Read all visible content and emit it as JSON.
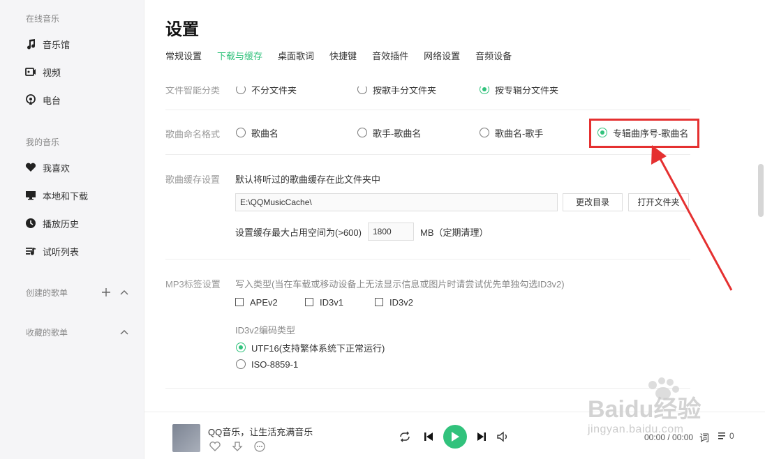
{
  "sidebar": {
    "online_title": "在线音乐",
    "online_items": [
      {
        "label": "音乐馆",
        "icon": "music-note-icon"
      },
      {
        "label": "视频",
        "icon": "video-icon"
      },
      {
        "label": "电台",
        "icon": "radio-icon"
      }
    ],
    "my_title": "我的音乐",
    "my_items": [
      {
        "label": "我喜欢",
        "icon": "heart-icon"
      },
      {
        "label": "本地和下载",
        "icon": "monitor-icon"
      },
      {
        "label": "播放历史",
        "icon": "clock-icon"
      },
      {
        "label": "试听列表",
        "icon": "playlist-icon"
      }
    ],
    "created_title": "创建的歌单",
    "collected_title": "收藏的歌单"
  },
  "header": {
    "title": "设置",
    "tabs": [
      {
        "label": "常规设置",
        "active": false
      },
      {
        "label": "下载与缓存",
        "active": true
      },
      {
        "label": "桌面歌词",
        "active": false
      },
      {
        "label": "快捷键",
        "active": false
      },
      {
        "label": "音效插件",
        "active": false
      },
      {
        "label": "网络设置",
        "active": false
      },
      {
        "label": "音频设备",
        "active": false
      }
    ]
  },
  "settings": {
    "smart_folder": {
      "label": "文件智能分类",
      "options": [
        "不分文件夹",
        "按歌手分文件夹",
        "按专辑分文件夹"
      ]
    },
    "naming": {
      "label": "歌曲命名格式",
      "options": [
        "歌曲名",
        "歌手-歌曲名",
        "歌曲名-歌手",
        "专辑曲序号-歌曲名"
      ],
      "selected": "专辑曲序号-歌曲名"
    },
    "cache": {
      "label": "歌曲缓存设置",
      "desc": "默认将听过的歌曲缓存在此文件夹中",
      "path": "E:\\QQMusicCache\\",
      "change_dir": "更改目录",
      "open_folder": "打开文件夹",
      "max_space_label": "设置缓存最大占用空间为(>600)",
      "max_space_value": "1800",
      "unit_note": "MB（定期清理）"
    },
    "mp3tag": {
      "label": "MP3标签设置",
      "desc": "写入类型(当在车载或移动设备上无法显示信息或图片时请尝试优先单独勾选ID3v2)",
      "types": [
        "APEv2",
        "ID3v1",
        "ID3v2"
      ],
      "encoding_title": "ID3v2编码类型",
      "encodings": [
        "UTF16(支持繁体系统下正常运行)",
        "ISO-8859-1"
      ],
      "encoding_selected": "UTF16(支持繁体系统下正常运行)"
    }
  },
  "player": {
    "song": "QQ音乐，让生活充满音乐",
    "time": "00:00 / 00:00",
    "lyric": "词",
    "list_count": "0"
  },
  "watermark": {
    "brand": "Baidu经验",
    "url": "jingyan.baidu.com"
  },
  "colors": {
    "accent": "#31c27c",
    "annotation": "#e53030"
  }
}
